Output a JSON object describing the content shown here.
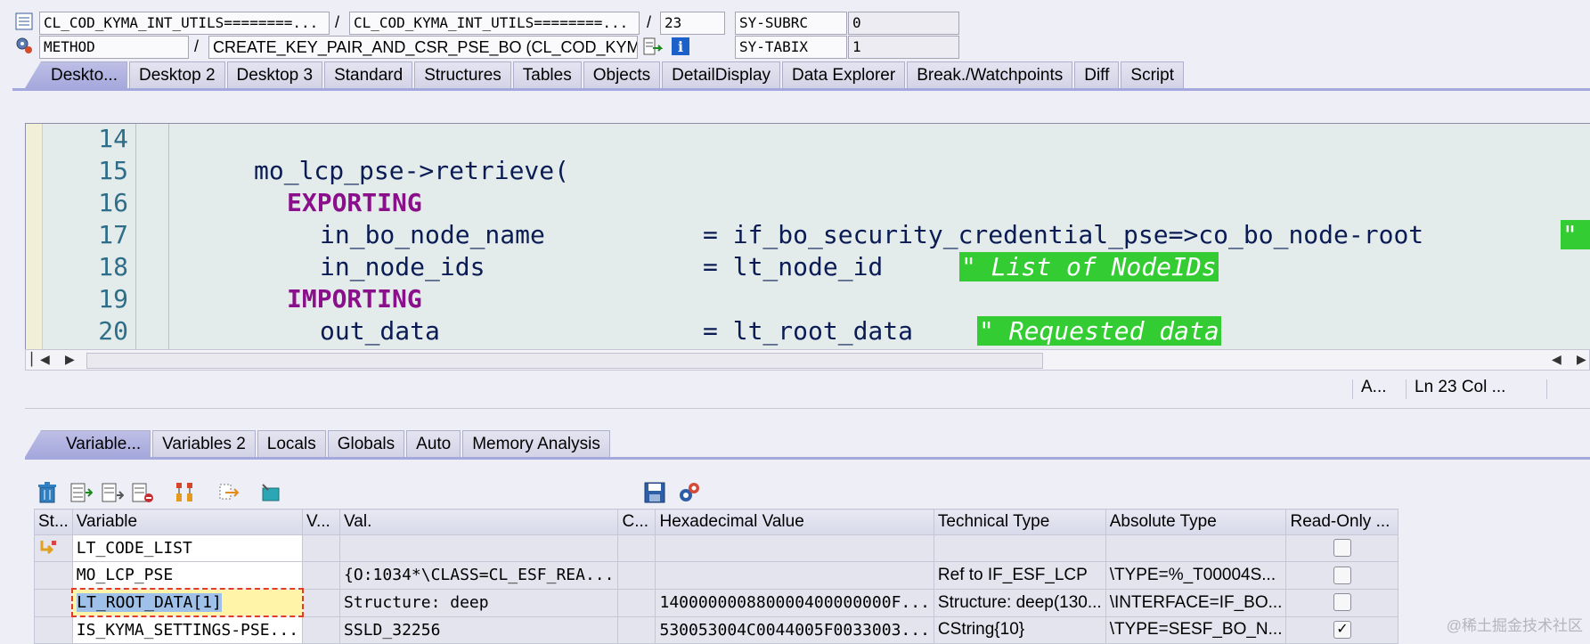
{
  "header": {
    "row1": {
      "program": "CL_COD_KYMA_INT_UTILS========...",
      "include": "CL_COD_KYMA_INT_UTILS========...",
      "line": "23",
      "var_name": "SY-SUBRC",
      "var_value": "0"
    },
    "row2": {
      "type": "METHOD",
      "name": "CREATE_KEY_PAIR_AND_CSR_PSE_BO (CL_COD_KYMA_IN...",
      "var_name": "SY-TABIX",
      "var_value": "1"
    },
    "separator": "/"
  },
  "desktop_tabs": [
    "Deskto...",
    "Desktop 2",
    "Desktop 3",
    "Standard",
    "Structures",
    "Tables",
    "Objects",
    "DetailDisplay",
    "Data Explorer",
    "Break./Watchpoints",
    "Diff",
    "Script"
  ],
  "editor": {
    "line_numbers": [
      "14",
      "15",
      "16",
      "17",
      "18",
      "19",
      "20"
    ],
    "lines": {
      "l15": "mo_lcp_pse->retrieve(",
      "l16": "EXPORTING",
      "l17_a": "in_bo_node_name",
      "l17_b": "= if_bo_security_credential_pse=>co_bo_node-root",
      "l17_c": "\" N",
      "l18_a": "in_node_ids",
      "l18_b": "= lt_node_id",
      "l18_c": "\" List of NodeIDs",
      "l19": "IMPORTING",
      "l20_a": "out_data",
      "l20_b": "= lt_root_data",
      "l20_c": "\" Requested data"
    }
  },
  "status_bar": {
    "mode": "A...",
    "position": "Ln  23 Col ..."
  },
  "var_tabs": [
    "Variable...",
    "Variables 2",
    "Locals",
    "Globals",
    "Auto",
    "Memory Analysis"
  ],
  "table": {
    "headers": [
      "St...",
      "Variable",
      "V...",
      "Val.",
      "C...",
      "Hexadecimal Value",
      "Technical Type",
      "Absolute Type",
      "Read-Only ..."
    ],
    "rows": [
      {
        "variable": "LT_CODE_LIST",
        "val": "",
        "hex": "",
        "tech": "",
        "abs": "",
        "readonly": false
      },
      {
        "variable": "MO_LCP_PSE",
        "val": "{O:1034*\\CLASS=CL_ESF_REA...",
        "hex": "",
        "tech": "Ref to IF_ESF_LCP",
        "abs": "\\TYPE=%_T00004S...",
        "readonly": false
      },
      {
        "variable": "LT_ROOT_DATA[1]",
        "val": "Structure: deep",
        "hex": "140000000880000400000000F...",
        "tech": "Structure: deep(130...",
        "abs": "\\INTERFACE=IF_BO...",
        "readonly": false
      },
      {
        "variable": "IS_KYMA_SETTINGS-PSE...",
        "val": "SSLD_32256",
        "hex": "530053004C0044005F0033003...",
        "tech": "CString{10}",
        "abs": "\\TYPE=SESF_BO_N...",
        "readonly": true
      }
    ]
  },
  "watermark": "@稀土掘金技术社区"
}
